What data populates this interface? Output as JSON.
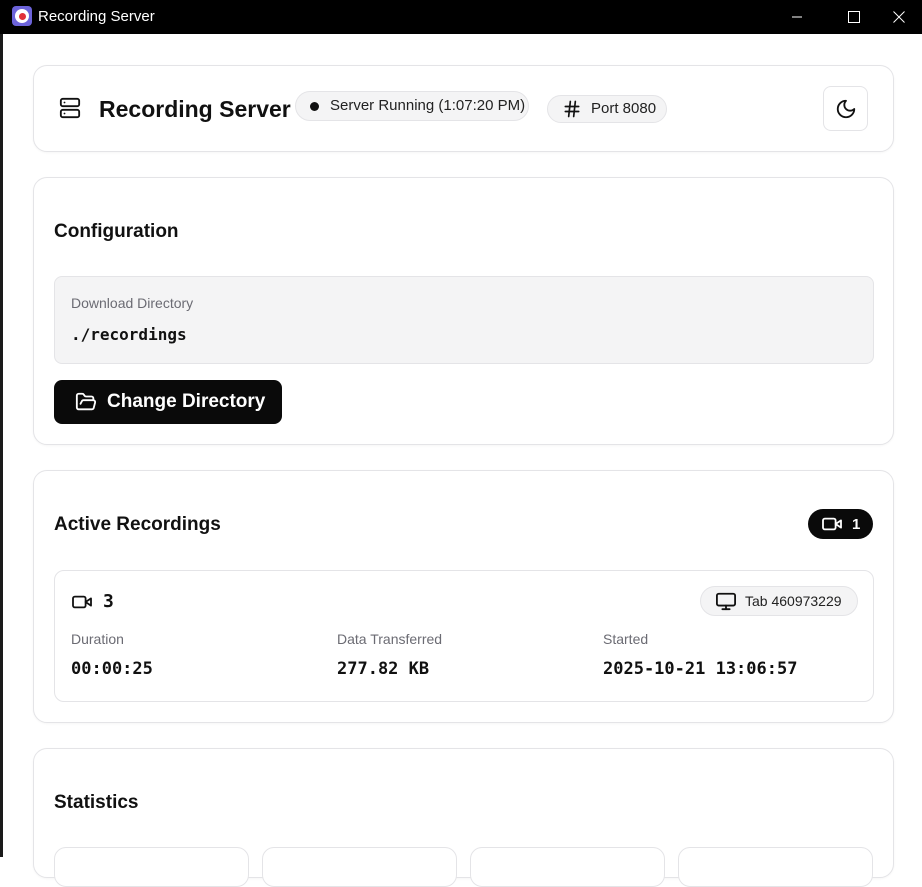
{
  "window": {
    "title": "Recording Server"
  },
  "header": {
    "title": "Recording Server",
    "status_text": "Server Running (1:07:20 PM)",
    "port_text": "Port 8080",
    "theme_toggle_icon": "moon-icon"
  },
  "configuration": {
    "title": "Configuration",
    "download_dir_label": "Download Directory",
    "download_dir_value": "./recordings",
    "change_button_label": "Change Directory"
  },
  "active_recordings": {
    "title": "Active Recordings",
    "count": "1",
    "recordings": [
      {
        "id": "3",
        "tab_label": "Tab 460973229",
        "duration_label": "Duration",
        "duration_value": "00:00:25",
        "data_label": "Data Transferred",
        "data_value": "277.82 KB",
        "started_label": "Started",
        "started_value": "2025-10-21 13:06:57"
      }
    ]
  },
  "statistics": {
    "title": "Statistics"
  },
  "colors": {
    "titlebar": "#000000",
    "primary_button": "#0a0a0a",
    "muted_text": "#6b6b73",
    "border": "#e4e4e7",
    "pill_bg": "#f4f4f5",
    "app_icon_bg": "#6c63d9",
    "app_icon_dot": "#e0303a"
  }
}
